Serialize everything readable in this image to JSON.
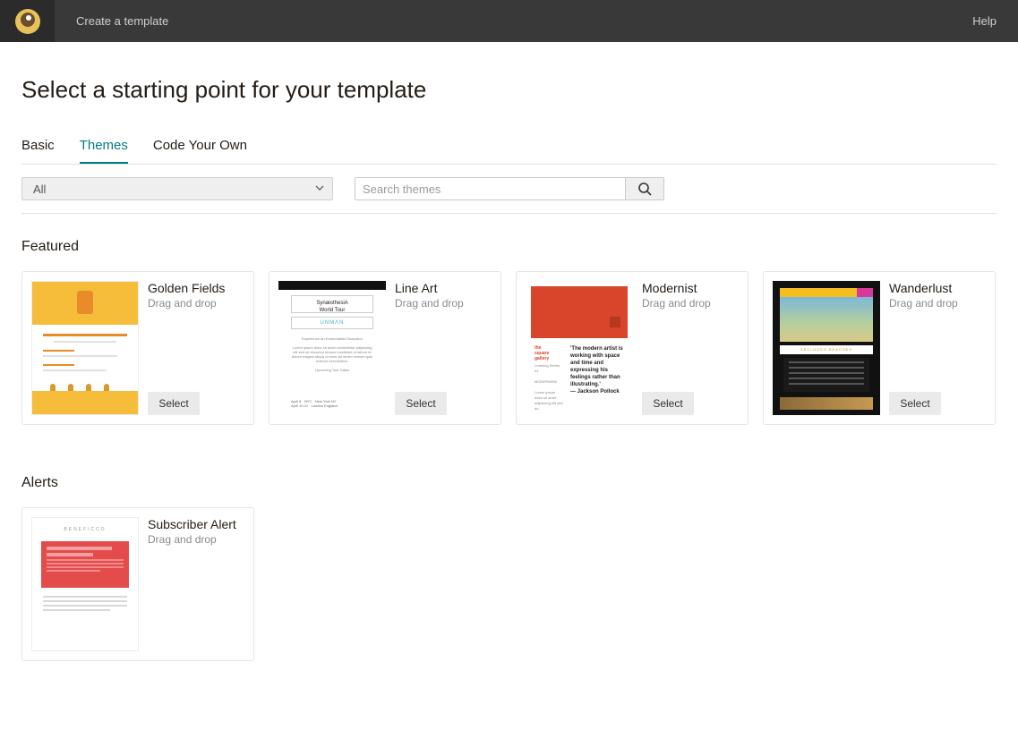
{
  "topbar": {
    "title": "Create a template",
    "help": "Help"
  },
  "page": {
    "heading": "Select a starting point for your template"
  },
  "tabs": {
    "basic": "Basic",
    "themes": "Themes",
    "code": "Code Your Own"
  },
  "filter": {
    "selected": "All",
    "search_placeholder": "Search themes"
  },
  "sections": {
    "featured": "Featured",
    "alerts": "Alerts"
  },
  "buttons": {
    "select": "Select"
  },
  "templates": {
    "featured": [
      {
        "title": "Golden Fields",
        "sub": "Drag and drop"
      },
      {
        "title": "Line Art",
        "sub": "Drag and drop"
      },
      {
        "title": "Modernist",
        "sub": "Drag and drop"
      },
      {
        "title": "Wanderlust",
        "sub": "Drag and drop"
      }
    ],
    "alerts": [
      {
        "title": "Subscriber Alert",
        "sub": "Drag and drop"
      }
    ]
  },
  "colors": {
    "accent": "#007c89",
    "topbar": "#393939"
  }
}
